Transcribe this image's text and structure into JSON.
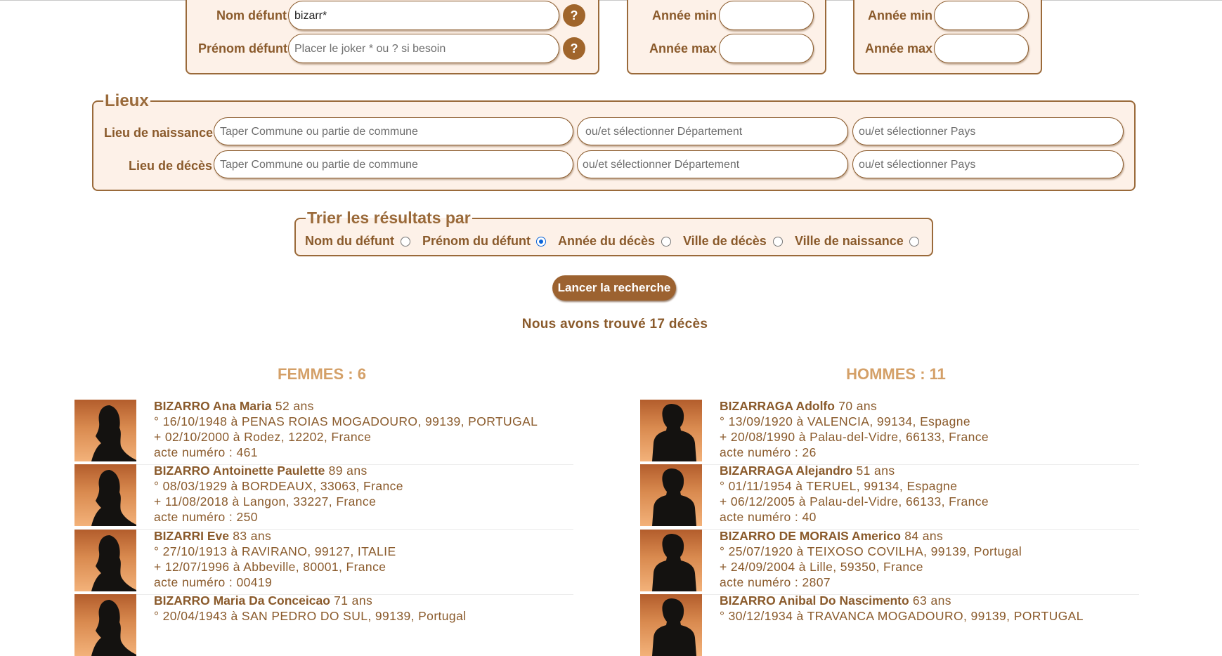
{
  "search": {
    "nom_label": "Nom défunt",
    "nom_value": "bizarr*",
    "prenom_label": "Prénom défunt",
    "prenom_placeholder": "Placer le joker * ou ? si besoin",
    "help_glyph": "?",
    "annee_min_label": "Année min",
    "annee_max_label": "Année max"
  },
  "lieux": {
    "legend": "Lieux",
    "naissance_label": "Lieu de naissance",
    "deces_label": "Lieu de décès",
    "commune_placeholder": "Taper Commune ou partie de commune",
    "departement_placeholder": "ou/et sélectionner Département",
    "pays_placeholder": "ou/et sélectionner Pays"
  },
  "sort": {
    "legend": "Trier les résultats par",
    "options": [
      {
        "label": "Nom du défunt",
        "selected": false
      },
      {
        "label": "Prénom du défunt",
        "selected": true
      },
      {
        "label": "Année du décès",
        "selected": false
      },
      {
        "label": "Ville de décès",
        "selected": false
      },
      {
        "label": "Ville de naissance",
        "selected": false
      }
    ]
  },
  "submit_label": "Lancer la recherche",
  "results_summary": "Nous avons trouvé 17 décès",
  "femmes": {
    "heading": "FEMMES : 6",
    "records": [
      {
        "name": "BIZARRO Ana Maria",
        "age": "52 ans",
        "birth": "° 16/10/1948 à PENAS ROIAS MOGADOURO, 99139, PORTUGAL",
        "death": "+ 02/10/2000 à Rodez, 12202, France",
        "acte": "acte numéro : 461"
      },
      {
        "name": "BIZARRO Antoinette Paulette",
        "age": "89 ans",
        "birth": "° 08/03/1929 à BORDEAUX, 33063, France",
        "death": "+ 11/08/2018 à Langon, 33227, France",
        "acte": "acte numéro : 250"
      },
      {
        "name": "BIZARRI Eve",
        "age": "83 ans",
        "birth": "° 27/10/1913 à RAVIRANO, 99127, ITALIE",
        "death": "+ 12/07/1996 à Abbeville, 80001, France",
        "acte": "acte numéro : 00419"
      },
      {
        "name": "BIZARRO Maria Da Conceicao",
        "age": "71 ans",
        "birth": "° 20/04/1943 à SAN PEDRO DO SUL, 99139, Portugal",
        "death": "",
        "acte": ""
      }
    ]
  },
  "hommes": {
    "heading": "HOMMES : 11",
    "records": [
      {
        "name": "BIZARRAGA Adolfo",
        "age": "70 ans",
        "birth": "° 13/09/1920 à VALENCIA, 99134, Espagne",
        "death": "+ 20/08/1990 à Palau-del-Vidre, 66133, France",
        "acte": "acte numéro : 26"
      },
      {
        "name": "BIZARRAGA Alejandro",
        "age": "51 ans",
        "birth": "° 01/11/1954 à TERUEL, 99134, Espagne",
        "death": "+ 06/12/2005 à Palau-del-Vidre, 66133, France",
        "acte": "acte numéro : 40"
      },
      {
        "name": "BIZARRO DE MORAIS Americo",
        "age": "84 ans",
        "birth": "° 25/07/1920 à TEIXOSO COVILHA, 99139, Portugal",
        "death": "+ 24/09/2004 à Lille, 59350, France",
        "acte": "acte numéro : 2807"
      },
      {
        "name": "BIZARRO Anibal Do Nascimento",
        "age": "63 ans",
        "birth": "° 30/12/1934 à TRAVANCA MOGADOURO, 99139, PORTUGAL",
        "death": "",
        "acte": ""
      }
    ]
  }
}
